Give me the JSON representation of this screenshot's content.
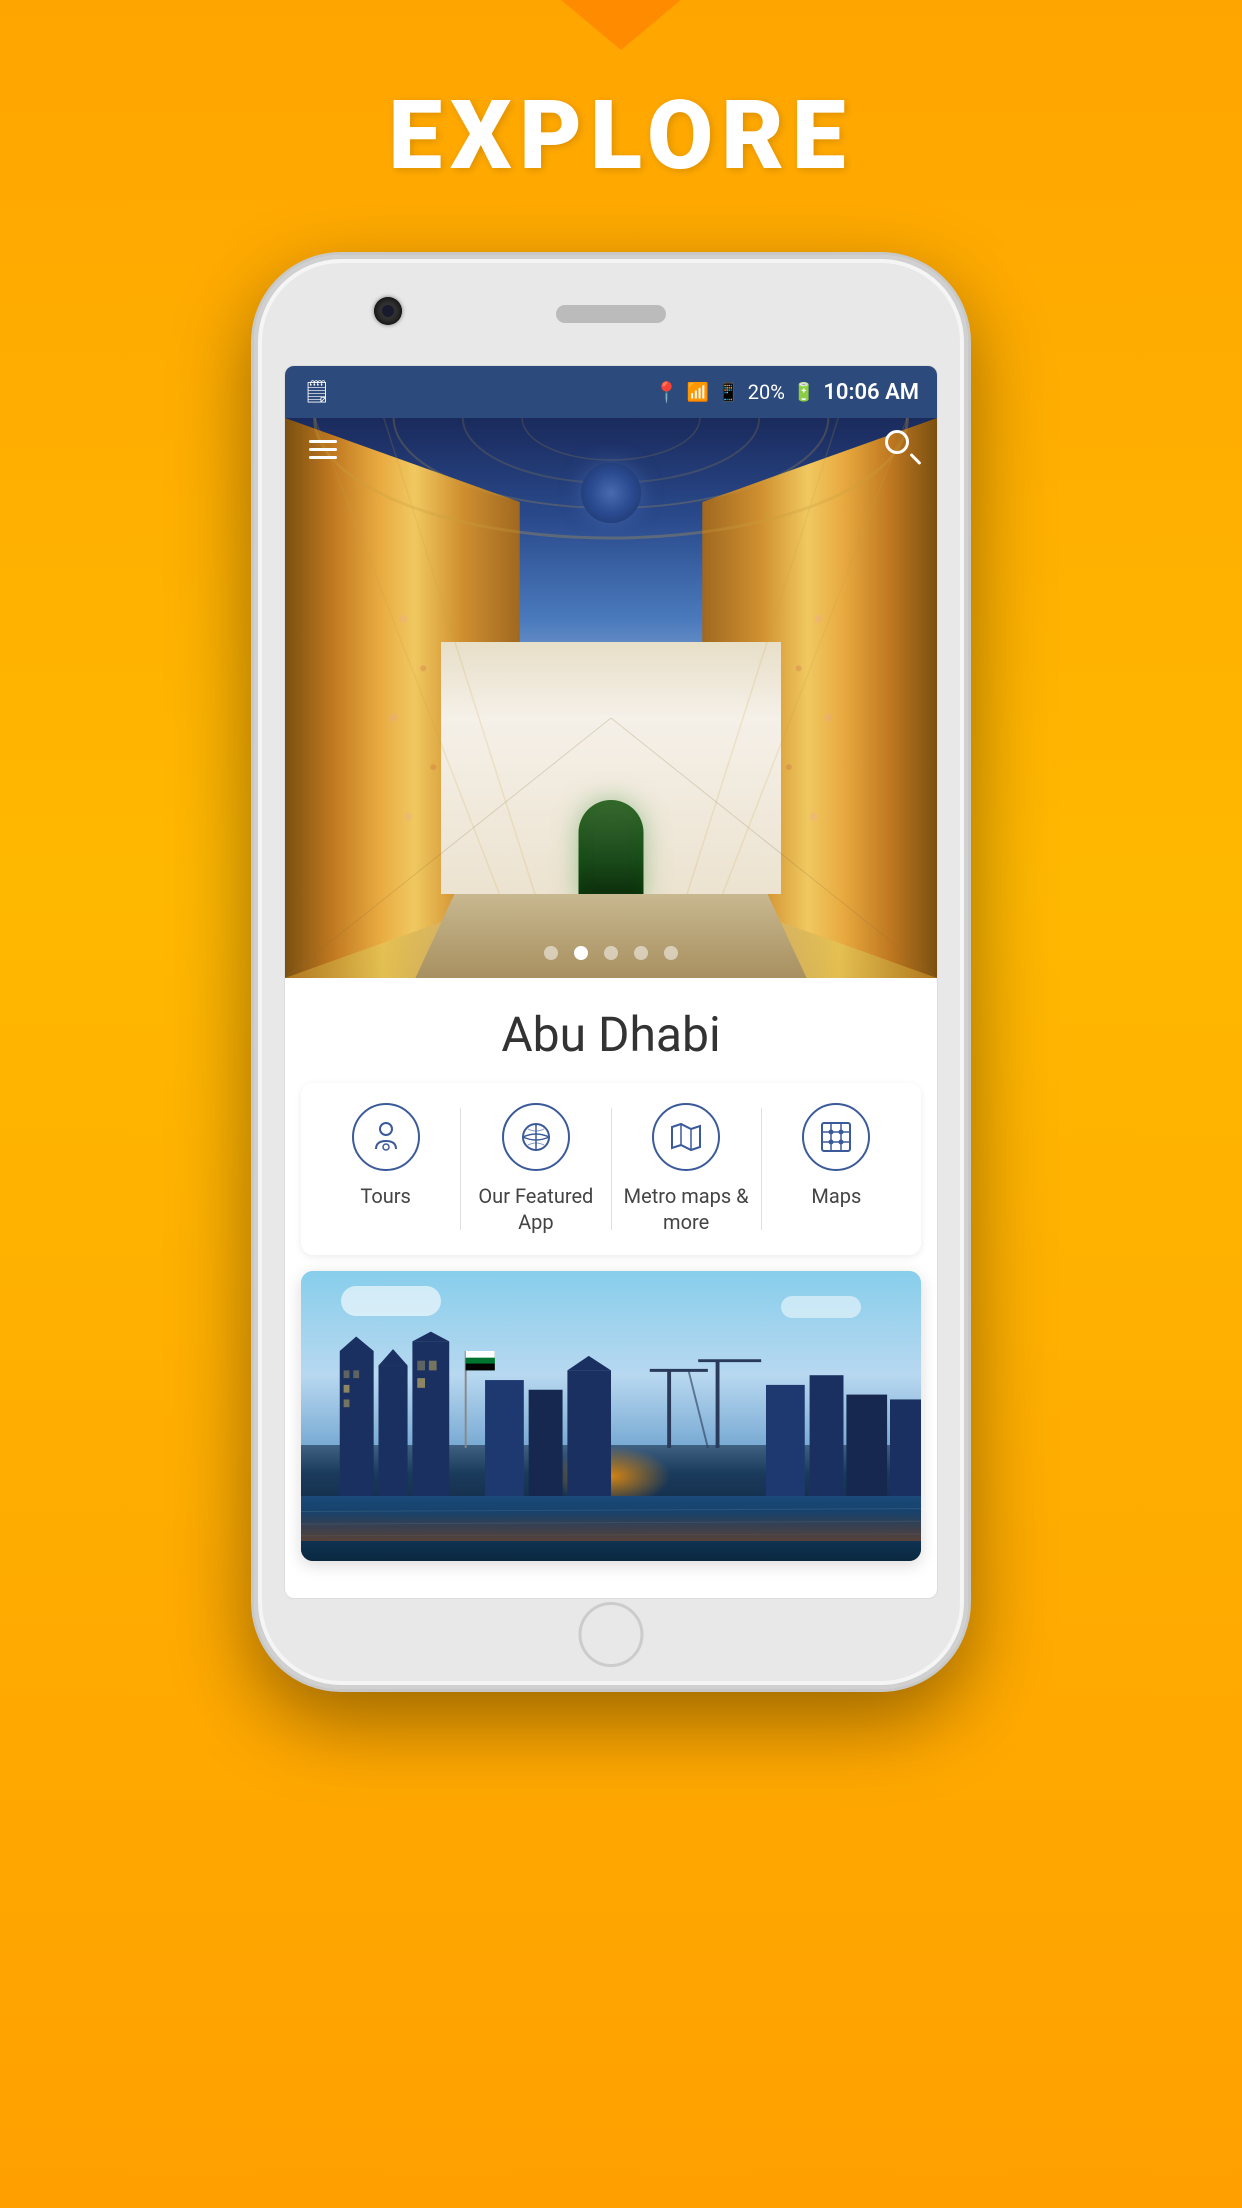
{
  "page": {
    "background_top": "#FFA500",
    "background_bottom": "#FF8C00"
  },
  "header": {
    "explore_label": "EXPLORE"
  },
  "status_bar": {
    "time": "10:06 AM",
    "battery_percent": "20%",
    "signal_bars": "▲▲",
    "wifi": "WiFi",
    "location": "📍"
  },
  "app": {
    "city_name": "Abu Dhabi",
    "menu_label": "Menu",
    "search_label": "Search",
    "carousel_dots": [
      {
        "active": false
      },
      {
        "active": true
      },
      {
        "active": false
      },
      {
        "active": false
      },
      {
        "active": false
      }
    ],
    "feature_cards": [
      {
        "id": "tours",
        "label": "Tours",
        "icon": "person-icon"
      },
      {
        "id": "featured_app",
        "label": "Our Featured App",
        "icon": "globe-icon"
      },
      {
        "id": "metro_maps",
        "label": "Metro maps & more",
        "icon": "map-icon"
      },
      {
        "id": "maps",
        "label": "Maps",
        "icon": "grid-map-icon"
      }
    ]
  }
}
